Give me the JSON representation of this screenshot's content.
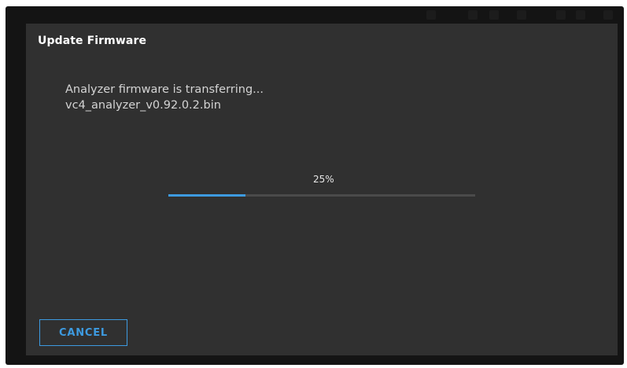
{
  "dialog": {
    "title": "Update Firmware",
    "message_line1": "Analyzer firmware is transferring...",
    "message_line2": "vc4_analyzer_v0.92.0.2.bin",
    "progress": {
      "label": "25%",
      "fraction": 0.25
    },
    "cancel_label": "CANCEL"
  },
  "colors": {
    "dialog_background": "#303030",
    "screen_background": "#141414",
    "accent": "#3d9ae0",
    "progress_track": "#4a4a4a",
    "title_text": "#ffffff",
    "body_text": "#d4d4d4"
  }
}
